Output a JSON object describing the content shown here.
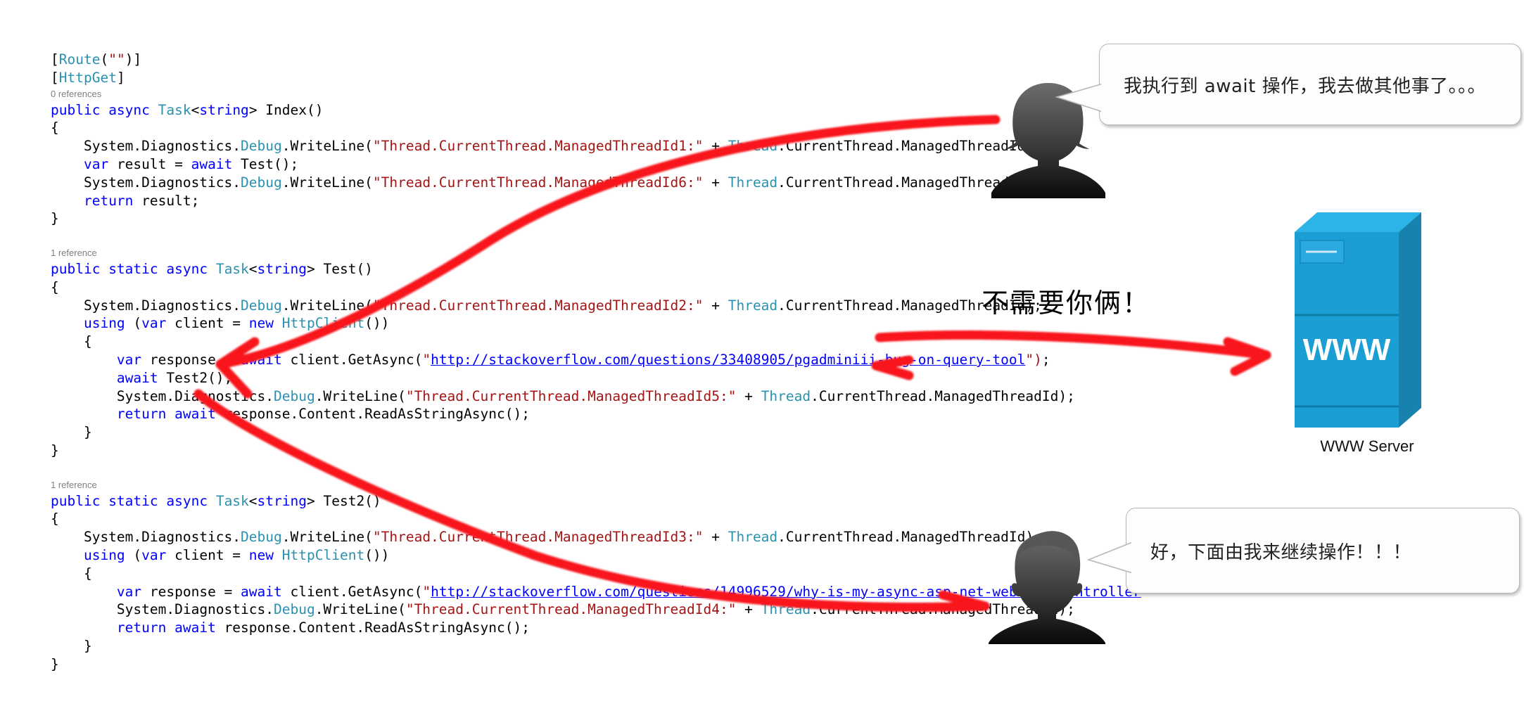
{
  "code": {
    "language": "csharp",
    "lines": [
      {
        "kind": "code",
        "segments": [
          {
            "t": "[",
            "c": "pl"
          },
          {
            "t": "Route",
            "c": "at"
          },
          {
            "t": "(",
            "c": "pl"
          },
          {
            "t": "\"\"",
            "c": "st"
          },
          {
            "t": ")]",
            "c": "pl"
          }
        ]
      },
      {
        "kind": "code",
        "segments": [
          {
            "t": "[",
            "c": "pl"
          },
          {
            "t": "HttpGet",
            "c": "at"
          },
          {
            "t": "]",
            "c": "pl"
          }
        ]
      },
      {
        "kind": "ref",
        "text": "0 references"
      },
      {
        "kind": "code",
        "segments": [
          {
            "t": "public ",
            "c": "kw"
          },
          {
            "t": "async ",
            "c": "kw"
          },
          {
            "t": "Task",
            "c": "ty"
          },
          {
            "t": "<",
            "c": "pl"
          },
          {
            "t": "string",
            "c": "kw"
          },
          {
            "t": "> Index()",
            "c": "pl"
          }
        ]
      },
      {
        "kind": "code",
        "segments": [
          {
            "t": "{",
            "c": "pl"
          }
        ]
      },
      {
        "kind": "code",
        "segments": [
          {
            "t": "    System.Diagnostics.",
            "c": "pl"
          },
          {
            "t": "Debug",
            "c": "ty"
          },
          {
            "t": ".WriteLine(",
            "c": "pl"
          },
          {
            "t": "\"Thread.CurrentThread.ManagedThreadId1:\"",
            "c": "st"
          },
          {
            "t": " + ",
            "c": "pl"
          },
          {
            "t": "Thread",
            "c": "ty"
          },
          {
            "t": ".CurrentThread.ManagedThreadId);",
            "c": "pl"
          }
        ]
      },
      {
        "kind": "code",
        "segments": [
          {
            "t": "    ",
            "c": "pl"
          },
          {
            "t": "var",
            "c": "kw"
          },
          {
            "t": " result = ",
            "c": "pl"
          },
          {
            "t": "await",
            "c": "kw"
          },
          {
            "t": " Test();",
            "c": "pl"
          }
        ]
      },
      {
        "kind": "code",
        "segments": [
          {
            "t": "    System.Diagnostics.",
            "c": "pl"
          },
          {
            "t": "Debug",
            "c": "ty"
          },
          {
            "t": ".WriteLine(",
            "c": "pl"
          },
          {
            "t": "\"Thread.CurrentThread.ManagedThreadId6:\"",
            "c": "st"
          },
          {
            "t": " + ",
            "c": "pl"
          },
          {
            "t": "Thread",
            "c": "ty"
          },
          {
            "t": ".CurrentThread.ManagedThreadId);",
            "c": "pl"
          }
        ]
      },
      {
        "kind": "code",
        "segments": [
          {
            "t": "    ",
            "c": "pl"
          },
          {
            "t": "return",
            "c": "kw"
          },
          {
            "t": " result;",
            "c": "pl"
          }
        ]
      },
      {
        "kind": "code",
        "segments": [
          {
            "t": "}",
            "c": "pl"
          }
        ]
      },
      {
        "kind": "blank",
        "segments": []
      },
      {
        "kind": "ref",
        "text": "1 reference"
      },
      {
        "kind": "code",
        "segments": [
          {
            "t": "public ",
            "c": "kw"
          },
          {
            "t": "static ",
            "c": "kw"
          },
          {
            "t": "async ",
            "c": "kw"
          },
          {
            "t": "Task",
            "c": "ty"
          },
          {
            "t": "<",
            "c": "pl"
          },
          {
            "t": "string",
            "c": "kw"
          },
          {
            "t": "> Test()",
            "c": "pl"
          }
        ]
      },
      {
        "kind": "code",
        "segments": [
          {
            "t": "{",
            "c": "pl"
          }
        ]
      },
      {
        "kind": "code",
        "segments": [
          {
            "t": "    System.Diagnostics.",
            "c": "pl"
          },
          {
            "t": "Debug",
            "c": "ty"
          },
          {
            "t": ".WriteLine(",
            "c": "pl"
          },
          {
            "t": "\"Thread.CurrentThread.ManagedThreadId2:\"",
            "c": "st"
          },
          {
            "t": " + ",
            "c": "pl"
          },
          {
            "t": "Thread",
            "c": "ty"
          },
          {
            "t": ".CurrentThread.ManagedThreadId);",
            "c": "pl"
          }
        ]
      },
      {
        "kind": "code",
        "segments": [
          {
            "t": "    ",
            "c": "pl"
          },
          {
            "t": "using",
            "c": "kw"
          },
          {
            "t": " (",
            "c": "pl"
          },
          {
            "t": "var",
            "c": "kw"
          },
          {
            "t": " client = ",
            "c": "pl"
          },
          {
            "t": "new",
            "c": "kw"
          },
          {
            "t": " ",
            "c": "pl"
          },
          {
            "t": "HttpClient",
            "c": "ty"
          },
          {
            "t": "())",
            "c": "pl"
          }
        ]
      },
      {
        "kind": "code",
        "segments": [
          {
            "t": "    {",
            "c": "pl"
          }
        ]
      },
      {
        "kind": "code",
        "segments": [
          {
            "t": "        ",
            "c": "pl"
          },
          {
            "t": "var",
            "c": "kw"
          },
          {
            "t": " response = ",
            "c": "pl"
          },
          {
            "t": "await",
            "c": "kw"
          },
          {
            "t": " client.GetAsync(",
            "c": "pl"
          },
          {
            "t": "\"",
            "c": "st"
          },
          {
            "t": "http://stackoverflow.com/questions/33408905/pgadminiii-bug-on-query-tool",
            "c": "lk"
          },
          {
            "t": "\")",
            "c": "st"
          },
          {
            "t": ";",
            "c": "pl"
          }
        ]
      },
      {
        "kind": "code",
        "segments": [
          {
            "t": "        ",
            "c": "pl"
          },
          {
            "t": "await",
            "c": "kw"
          },
          {
            "t": " Test2();",
            "c": "pl"
          }
        ]
      },
      {
        "kind": "code",
        "segments": [
          {
            "t": "        System.Diagnostics.",
            "c": "pl"
          },
          {
            "t": "Debug",
            "c": "ty"
          },
          {
            "t": ".WriteLine(",
            "c": "pl"
          },
          {
            "t": "\"Thread.CurrentThread.ManagedThreadId5:\"",
            "c": "st"
          },
          {
            "t": " + ",
            "c": "pl"
          },
          {
            "t": "Thread",
            "c": "ty"
          },
          {
            "t": ".CurrentThread.ManagedThreadId);",
            "c": "pl"
          }
        ]
      },
      {
        "kind": "code",
        "segments": [
          {
            "t": "        ",
            "c": "pl"
          },
          {
            "t": "return",
            "c": "kw"
          },
          {
            "t": " ",
            "c": "pl"
          },
          {
            "t": "await",
            "c": "kw"
          },
          {
            "t": " response.Content.ReadAsStringAsync();",
            "c": "pl"
          }
        ]
      },
      {
        "kind": "code",
        "segments": [
          {
            "t": "    }",
            "c": "pl"
          }
        ]
      },
      {
        "kind": "code",
        "segments": [
          {
            "t": "}",
            "c": "pl"
          }
        ]
      },
      {
        "kind": "blank",
        "segments": []
      },
      {
        "kind": "ref",
        "text": "1 reference"
      },
      {
        "kind": "code",
        "segments": [
          {
            "t": "public ",
            "c": "kw"
          },
          {
            "t": "static ",
            "c": "kw"
          },
          {
            "t": "async ",
            "c": "kw"
          },
          {
            "t": "Task",
            "c": "ty"
          },
          {
            "t": "<",
            "c": "pl"
          },
          {
            "t": "string",
            "c": "kw"
          },
          {
            "t": "> Test2()",
            "c": "pl"
          }
        ]
      },
      {
        "kind": "code",
        "segments": [
          {
            "t": "{",
            "c": "pl"
          }
        ]
      },
      {
        "kind": "code",
        "segments": [
          {
            "t": "    System.Diagnostics.",
            "c": "pl"
          },
          {
            "t": "Debug",
            "c": "ty"
          },
          {
            "t": ".WriteLine(",
            "c": "pl"
          },
          {
            "t": "\"Thread.CurrentThread.ManagedThreadId3:\"",
            "c": "st"
          },
          {
            "t": " + ",
            "c": "pl"
          },
          {
            "t": "Thread",
            "c": "ty"
          },
          {
            "t": ".CurrentThread.ManagedThreadId);",
            "c": "pl"
          }
        ]
      },
      {
        "kind": "code",
        "segments": [
          {
            "t": "    ",
            "c": "pl"
          },
          {
            "t": "using",
            "c": "kw"
          },
          {
            "t": " (",
            "c": "pl"
          },
          {
            "t": "var",
            "c": "kw"
          },
          {
            "t": " client = ",
            "c": "pl"
          },
          {
            "t": "new",
            "c": "kw"
          },
          {
            "t": " ",
            "c": "pl"
          },
          {
            "t": "HttpClient",
            "c": "ty"
          },
          {
            "t": "())",
            "c": "pl"
          }
        ]
      },
      {
        "kind": "code",
        "segments": [
          {
            "t": "    {",
            "c": "pl"
          }
        ]
      },
      {
        "kind": "code",
        "segments": [
          {
            "t": "        ",
            "c": "pl"
          },
          {
            "t": "var",
            "c": "kw"
          },
          {
            "t": " response = ",
            "c": "pl"
          },
          {
            "t": "await",
            "c": "kw"
          },
          {
            "t": " client.GetAsync(",
            "c": "pl"
          },
          {
            "t": "\"",
            "c": "st"
          },
          {
            "t": "http://stackoverflow.com/questions/14996529/why-is-my-async-asp-net-web-api-controller",
            "c": "lk"
          }
        ]
      },
      {
        "kind": "code",
        "segments": [
          {
            "t": "        System.Diagnostics.",
            "c": "pl"
          },
          {
            "t": "Debug",
            "c": "ty"
          },
          {
            "t": ".WriteLine(",
            "c": "pl"
          },
          {
            "t": "\"Thread.CurrentThread.ManagedThreadId4:\"",
            "c": "st"
          },
          {
            "t": " + ",
            "c": "pl"
          },
          {
            "t": "Thread",
            "c": "ty"
          },
          {
            "t": ".CurrentThread.ManagedThreadId);",
            "c": "pl"
          }
        ]
      },
      {
        "kind": "code",
        "segments": [
          {
            "t": "        ",
            "c": "pl"
          },
          {
            "t": "return",
            "c": "kw"
          },
          {
            "t": " ",
            "c": "pl"
          },
          {
            "t": "await",
            "c": "kw"
          },
          {
            "t": " response.Content.ReadAsStringAsync();",
            "c": "pl"
          }
        ]
      },
      {
        "kind": "code",
        "segments": [
          {
            "t": "    }",
            "c": "pl"
          }
        ]
      },
      {
        "kind": "code",
        "segments": [
          {
            "t": "}",
            "c": "pl"
          }
        ]
      }
    ],
    "colors": {
      "keyword": "#0000ff",
      "type": "#2b91af",
      "string": "#a31515",
      "link": "#0000ff",
      "reference": "#808080",
      "plain": "#000000"
    }
  },
  "annotations": {
    "arrow_color": "#f8141e",
    "center_note": "不需要你俩！"
  },
  "bubbles": {
    "top": {
      "text": "我执行到 await 操作，我去做其他事了。。。"
    },
    "bottom": {
      "text": "好，下面由我来继续操作！！！"
    }
  },
  "server": {
    "face_label": "WWW",
    "caption": "WWW Server",
    "colors": {
      "front": "#1a9ed4",
      "side": "#1782ad",
      "top": "#2cb4e8",
      "slot": "#29a9e0"
    }
  },
  "people": {
    "top": {
      "role": "caller-thread"
    },
    "bottom": {
      "role": "continuation-thread"
    }
  }
}
